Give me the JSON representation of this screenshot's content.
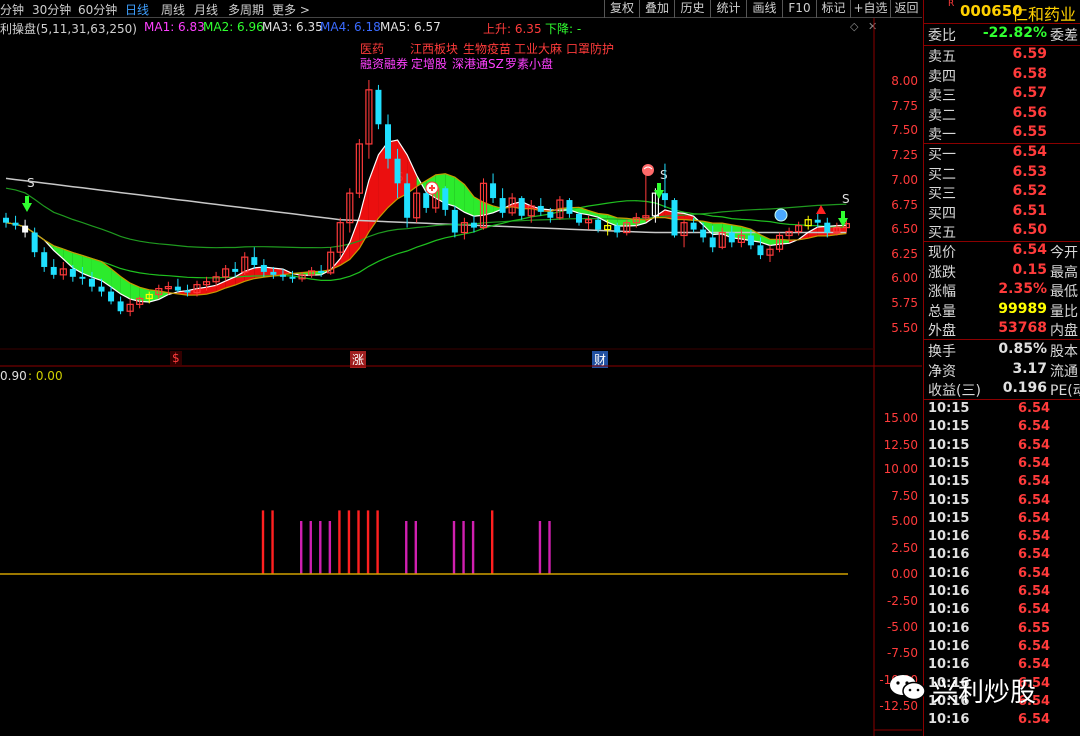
{
  "toolbar": {
    "periods": [
      "分钟",
      "30分钟",
      "60分钟",
      "日线",
      "周线",
      "月线",
      "多周期",
      "更多 >"
    ],
    "active_period": "日线",
    "buttons": [
      "复权",
      "叠加",
      "历史",
      "统计",
      "画线",
      "F10",
      "标记",
      "+自选",
      "返回"
    ]
  },
  "indicator": {
    "name": "利操盘(5,11,31,63,250)",
    "ma1": "MA1: 6.83",
    "ma2": "MA2: 6.96",
    "ma3": "MA3: 6.35",
    "ma4": "MA4: 6.18",
    "ma5": "MA5: 6.57",
    "up": "上升: 6.35",
    "down": "下降: -"
  },
  "concepts": {
    "line1": [
      "医药",
      "江西板块",
      "生物疫苗",
      "工业大麻",
      "口罩防护"
    ],
    "line2": [
      "融资融券",
      "定增股",
      "深港通SZ",
      "罗素小盘"
    ]
  },
  "price_axis": [
    "8.00",
    "7.75",
    "7.50",
    "7.25",
    "7.00",
    "6.75",
    "6.50",
    "6.25",
    "6.00",
    "5.75",
    "5.50"
  ],
  "event_markers": [
    "$",
    "涨",
    "财"
  ],
  "markers": {
    "s1": "S",
    "s2": "S",
    "s3": "S",
    "s4": "S"
  },
  "lower_panel": {
    "header_values": [
      "0.90",
      ": 0.00"
    ],
    "axis": [
      "15.00",
      "12.50",
      "10.00",
      "7.50",
      "5.00",
      "2.50",
      "0.00",
      "-2.50",
      "-5.00",
      "-7.50",
      "-10.00",
      "-12.50"
    ]
  },
  "chart_data": {
    "type": "candlestick",
    "ylim": [
      5.35,
      8.15
    ],
    "candles": [
      [
        6.6,
        6.65,
        6.5,
        6.55
      ],
      [
        6.55,
        6.62,
        6.48,
        6.52
      ],
      [
        6.52,
        6.58,
        6.4,
        6.45
      ],
      [
        6.45,
        6.5,
        6.2,
        6.25
      ],
      [
        6.25,
        6.3,
        6.05,
        6.1
      ],
      [
        6.1,
        6.18,
        5.98,
        6.02
      ],
      [
        6.02,
        6.15,
        5.97,
        6.08
      ],
      [
        6.08,
        6.12,
        5.95,
        6.0
      ],
      [
        6.0,
        6.1,
        5.92,
        5.98
      ],
      [
        5.98,
        6.05,
        5.85,
        5.9
      ],
      [
        5.9,
        5.98,
        5.8,
        5.85
      ],
      [
        5.85,
        5.9,
        5.72,
        5.75
      ],
      [
        5.75,
        5.8,
        5.62,
        5.65
      ],
      [
        5.65,
        5.78,
        5.6,
        5.72
      ],
      [
        5.72,
        5.8,
        5.68,
        5.78
      ],
      [
        5.78,
        5.85,
        5.73,
        5.82
      ],
      [
        5.82,
        5.92,
        5.78,
        5.88
      ],
      [
        5.88,
        5.95,
        5.82,
        5.9
      ],
      [
        5.9,
        5.98,
        5.84,
        5.86
      ],
      [
        5.86,
        5.92,
        5.8,
        5.84
      ],
      [
        5.84,
        5.96,
        5.8,
        5.92
      ],
      [
        5.92,
        6.0,
        5.86,
        5.95
      ],
      [
        5.95,
        6.05,
        5.9,
        6.0
      ],
      [
        6.0,
        6.12,
        5.96,
        6.08
      ],
      [
        6.08,
        6.15,
        6.0,
        6.05
      ],
      [
        6.05,
        6.25,
        6.02,
        6.2
      ],
      [
        6.2,
        6.3,
        6.08,
        6.12
      ],
      [
        6.12,
        6.18,
        6.0,
        6.05
      ],
      [
        6.05,
        6.1,
        5.98,
        6.02
      ],
      [
        6.02,
        6.08,
        5.96,
        6.0
      ],
      [
        6.0,
        6.06,
        5.94,
        5.98
      ],
      [
        5.98,
        6.05,
        5.95,
        6.02
      ],
      [
        6.02,
        6.1,
        5.99,
        6.06
      ],
      [
        6.06,
        6.12,
        6.0,
        6.04
      ],
      [
        6.04,
        6.3,
        6.02,
        6.25
      ],
      [
        6.25,
        6.6,
        6.2,
        6.55
      ],
      [
        6.55,
        6.9,
        6.45,
        6.85
      ],
      [
        6.85,
        7.4,
        6.8,
        7.35
      ],
      [
        7.35,
        8.0,
        7.2,
        7.9
      ],
      [
        7.9,
        7.95,
        7.5,
        7.55
      ],
      [
        7.55,
        7.65,
        7.1,
        7.2
      ],
      [
        7.2,
        7.3,
        6.8,
        6.95
      ],
      [
        6.95,
        7.05,
        6.5,
        6.6
      ],
      [
        6.6,
        6.92,
        6.55,
        6.85
      ],
      [
        6.85,
        6.9,
        6.65,
        6.7
      ],
      [
        6.7,
        6.95,
        6.65,
        6.9
      ],
      [
        6.9,
        6.92,
        6.62,
        6.68
      ],
      [
        6.68,
        6.72,
        6.4,
        6.45
      ],
      [
        6.45,
        6.6,
        6.38,
        6.55
      ],
      [
        6.55,
        6.62,
        6.45,
        6.5
      ],
      [
        6.5,
        7.0,
        6.48,
        6.95
      ],
      [
        6.95,
        7.05,
        6.75,
        6.8
      ],
      [
        6.8,
        6.9,
        6.6,
        6.65
      ],
      [
        6.65,
        6.85,
        6.62,
        6.8
      ],
      [
        6.8,
        6.82,
        6.58,
        6.62
      ],
      [
        6.62,
        6.78,
        6.55,
        6.72
      ],
      [
        6.72,
        6.8,
        6.62,
        6.66
      ],
      [
        6.66,
        6.7,
        6.55,
        6.6
      ],
      [
        6.6,
        6.82,
        6.58,
        6.78
      ],
      [
        6.78,
        6.8,
        6.6,
        6.64
      ],
      [
        6.64,
        6.66,
        6.52,
        6.55
      ],
      [
        6.55,
        6.62,
        6.48,
        6.58
      ],
      [
        6.58,
        6.6,
        6.45,
        6.48
      ],
      [
        6.48,
        6.58,
        6.42,
        6.52
      ],
      [
        6.52,
        6.55,
        6.4,
        6.45
      ],
      [
        6.45,
        6.58,
        6.42,
        6.55
      ],
      [
        6.55,
        6.65,
        6.5,
        6.6
      ],
      [
        6.6,
        7.05,
        6.58,
        6.62
      ],
      [
        6.62,
        6.9,
        6.55,
        6.85
      ],
      [
        6.85,
        7.15,
        6.7,
        6.78
      ],
      [
        6.78,
        6.8,
        6.4,
        6.42
      ],
      [
        6.42,
        6.58,
        6.3,
        6.55
      ],
      [
        6.55,
        6.6,
        6.45,
        6.48
      ],
      [
        6.48,
        6.55,
        6.35,
        6.4
      ],
      [
        6.4,
        6.52,
        6.25,
        6.3
      ],
      [
        6.3,
        6.5,
        6.28,
        6.45
      ],
      [
        6.45,
        6.52,
        6.3,
        6.35
      ],
      [
        6.35,
        6.48,
        6.3,
        6.42
      ],
      [
        6.42,
        6.48,
        6.28,
        6.32
      ],
      [
        6.32,
        6.4,
        6.18,
        6.22
      ],
      [
        6.22,
        6.32,
        6.15,
        6.28
      ],
      [
        6.28,
        6.45,
        6.25,
        6.42
      ],
      [
        6.42,
        6.5,
        6.38,
        6.46
      ],
      [
        6.46,
        6.56,
        6.42,
        6.52
      ],
      [
        6.52,
        6.62,
        6.48,
        6.58
      ],
      [
        6.58,
        6.64,
        6.5,
        6.55
      ],
      [
        6.55,
        6.6,
        6.4,
        6.45
      ],
      [
        6.45,
        6.55,
        6.42,
        6.5
      ],
      [
        6.5,
        6.58,
        6.45,
        6.54
      ]
    ],
    "histogram": [
      {
        "i": 25,
        "v": 6.0,
        "c": "red"
      },
      {
        "i": 26,
        "v": 6.0,
        "c": "red"
      },
      {
        "i": 29,
        "v": 5.0,
        "c": "magenta"
      },
      {
        "i": 30,
        "v": 5.0,
        "c": "magenta"
      },
      {
        "i": 31,
        "v": 5.0,
        "c": "magenta"
      },
      {
        "i": 32,
        "v": 5.0,
        "c": "magenta"
      },
      {
        "i": 33,
        "v": 6.0,
        "c": "red"
      },
      {
        "i": 34,
        "v": 6.0,
        "c": "red"
      },
      {
        "i": 35,
        "v": 6.0,
        "c": "red"
      },
      {
        "i": 36,
        "v": 6.0,
        "c": "red"
      },
      {
        "i": 37,
        "v": 6.0,
        "c": "red"
      },
      {
        "i": 40,
        "v": 5.0,
        "c": "magenta"
      },
      {
        "i": 41,
        "v": 5.0,
        "c": "magenta"
      },
      {
        "i": 45,
        "v": 5.0,
        "c": "magenta"
      },
      {
        "i": 46,
        "v": 5.0,
        "c": "magenta"
      },
      {
        "i": 47,
        "v": 5.0,
        "c": "magenta"
      },
      {
        "i": 49,
        "v": 6.0,
        "c": "red"
      },
      {
        "i": 54,
        "v": 5.0,
        "c": "magenta"
      },
      {
        "i": 55,
        "v": 5.0,
        "c": "magenta"
      }
    ],
    "hist_ylim": [
      -15.0,
      20.0
    ],
    "colors": {
      "up": "#ff3b3b",
      "down": "#20e0ff",
      "yellow": "#ffff00",
      "green_band": "#30ff30",
      "red_band": "#ff1010",
      "white_line": "#e0e0e0"
    }
  },
  "quote": {
    "code": "000650",
    "name": "仁和药业",
    "badge": "R",
    "weibi_label": "委比",
    "weibi_value": "-22.82%",
    "weicha_label": "委差",
    "asks": [
      {
        "label": "卖五",
        "price": "6.59"
      },
      {
        "label": "卖四",
        "price": "6.58"
      },
      {
        "label": "卖三",
        "price": "6.57"
      },
      {
        "label": "卖二",
        "price": "6.56"
      },
      {
        "label": "卖一",
        "price": "6.55"
      }
    ],
    "bids": [
      {
        "label": "买一",
        "price": "6.54"
      },
      {
        "label": "买二",
        "price": "6.53"
      },
      {
        "label": "买三",
        "price": "6.52"
      },
      {
        "label": "买四",
        "price": "6.51"
      },
      {
        "label": "买五",
        "price": "6.50"
      }
    ],
    "stats": [
      {
        "label": "现价",
        "value": "6.54",
        "extra": "今开",
        "color": "#ff3b3b"
      },
      {
        "label": "涨跌",
        "value": "0.15",
        "extra": "最高",
        "color": "#ff3b3b"
      },
      {
        "label": "涨幅",
        "value": "2.35%",
        "extra": "最低",
        "color": "#ff3b3b"
      },
      {
        "label": "总量",
        "value": "99989",
        "extra": "量比",
        "color": "#ffff00"
      },
      {
        "label": "外盘",
        "value": "53768",
        "extra": "内盘",
        "color": "#ff3b3b"
      }
    ],
    "stats2": [
      {
        "label": "换手",
        "value": "0.85%",
        "extra": "股本"
      },
      {
        "label": "净资",
        "value": "3.17",
        "extra": "流通"
      },
      {
        "label": "收益(三)",
        "value": "0.196",
        "extra": "PE(动"
      }
    ],
    "ticks": [
      {
        "time": "10:15",
        "price": "6.54"
      },
      {
        "time": "10:15",
        "price": "6.54"
      },
      {
        "time": "10:15",
        "price": "6.54"
      },
      {
        "time": "10:15",
        "price": "6.54"
      },
      {
        "time": "10:15",
        "price": "6.54"
      },
      {
        "time": "10:15",
        "price": "6.54"
      },
      {
        "time": "10:15",
        "price": "6.54"
      },
      {
        "time": "10:16",
        "price": "6.54"
      },
      {
        "time": "10:16",
        "price": "6.54"
      },
      {
        "time": "10:16",
        "price": "6.54"
      },
      {
        "time": "10:16",
        "price": "6.54"
      },
      {
        "time": "10:16",
        "price": "6.54"
      },
      {
        "time": "10:16",
        "price": "6.55"
      },
      {
        "time": "10:16",
        "price": "6.54"
      },
      {
        "time": "10:16",
        "price": "6.54"
      },
      {
        "time": "10:16",
        "price": "6.54"
      },
      {
        "time": "10:16",
        "price": "6.54"
      },
      {
        "time": "10:16",
        "price": "6.54"
      }
    ]
  },
  "watermark": "兴利炒股"
}
